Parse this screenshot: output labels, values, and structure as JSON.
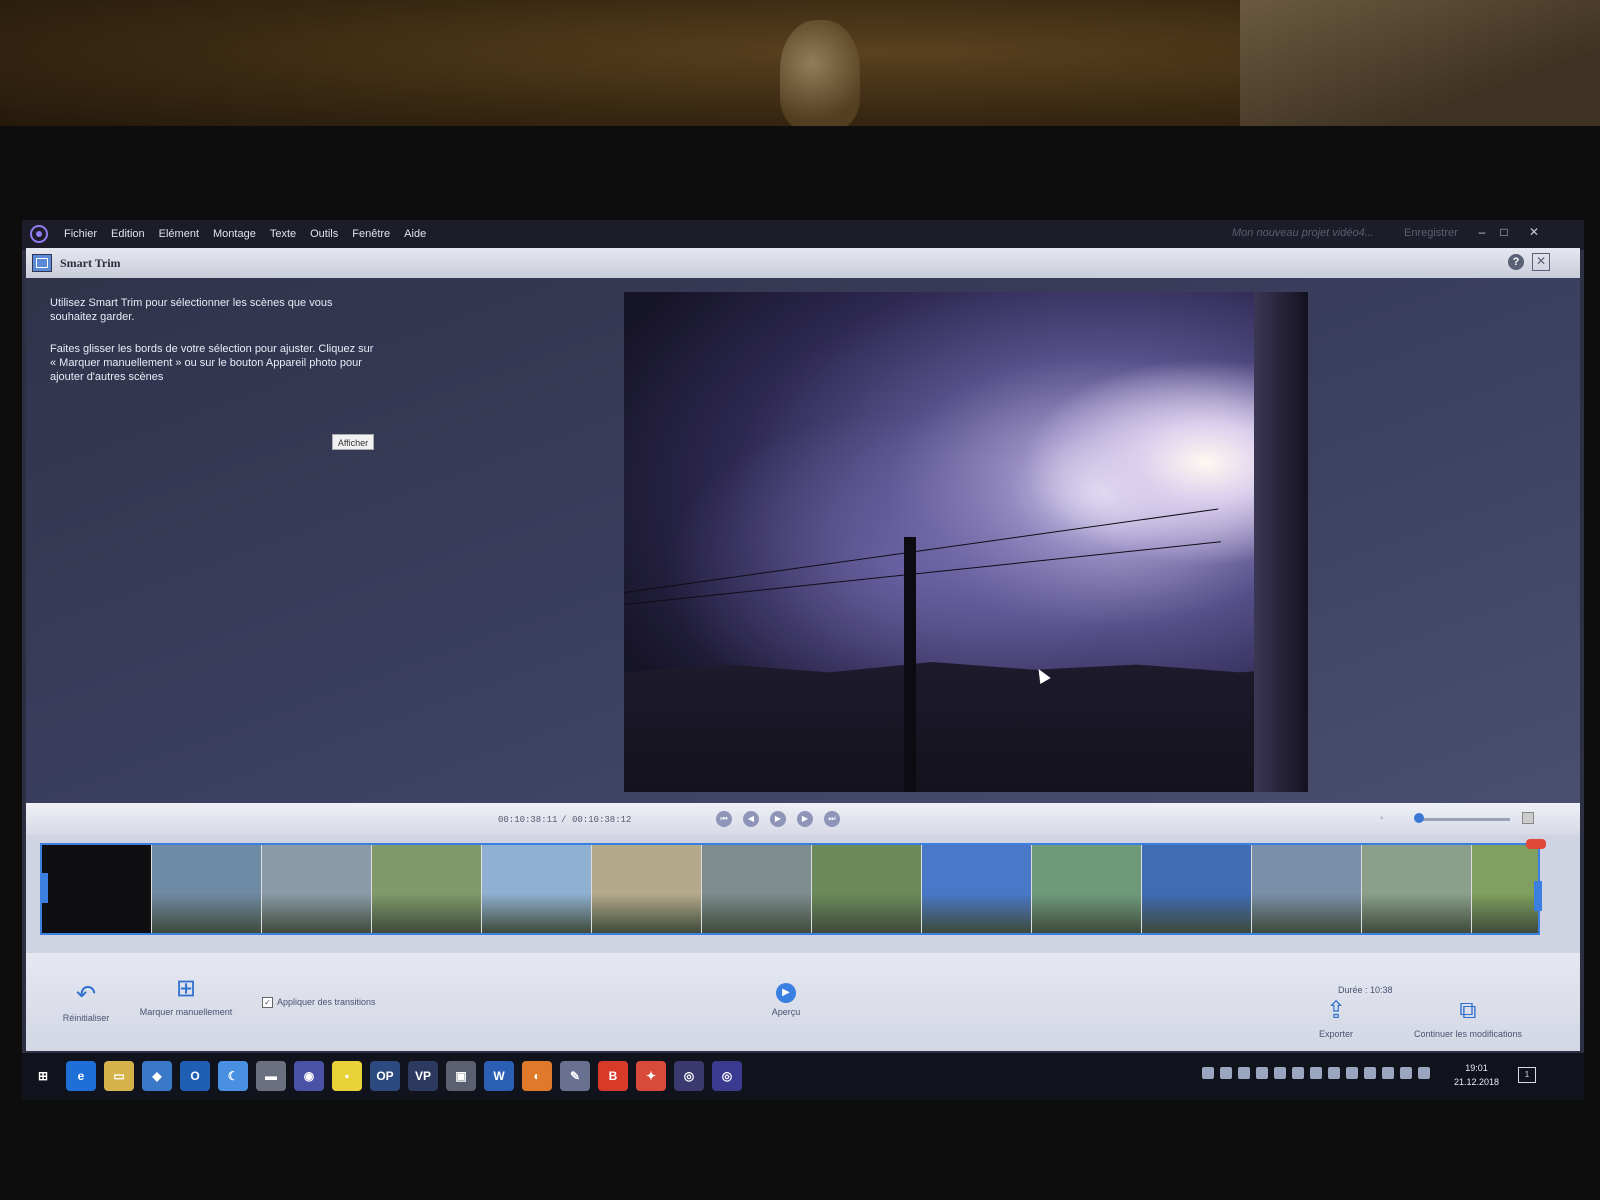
{
  "menubar": {
    "items": [
      "Fichier",
      "Edition",
      "Elément",
      "Montage",
      "Texte",
      "Outils",
      "Fenêtre",
      "Aide"
    ],
    "project_title": "Mon nouveau projet vidéo4...",
    "save_label": "Enregistrer"
  },
  "panel": {
    "title": "Smart Trim",
    "help_label": "?",
    "close_label": "✕"
  },
  "instructions": {
    "paragraph1": "Utilisez Smart Trim pour sélectionner les scènes que vous souhaitez garder.",
    "paragraph2": "Faites glisser les bords de votre sélection pour ajuster. Cliquez sur « Marquer  manuellement » ou sur le bouton Appareil photo pour ajouter d'autres scènes",
    "show_button": "Afficher"
  },
  "transport": {
    "current_time": "00:10:38:11",
    "separator": "/",
    "total_time": "00:10:38:12",
    "buttons": [
      "first-frame-icon",
      "previous-frame-icon",
      "play-icon",
      "next-frame-icon",
      "last-frame-icon"
    ]
  },
  "filmstrip": {
    "thumbnails": [
      {
        "scene": "dark",
        "color": "#0f0f12"
      },
      {
        "scene": "village",
        "color": "#6f8aa4"
      },
      {
        "scene": "house",
        "color": "#8a9aa6"
      },
      {
        "scene": "trees",
        "color": "#7f9a6a"
      },
      {
        "scene": "town",
        "color": "#8fb0d0"
      },
      {
        "scene": "field",
        "color": "#b4a98a"
      },
      {
        "scene": "car",
        "color": "#7d8c8f"
      },
      {
        "scene": "bushes",
        "color": "#6a8a5a"
      },
      {
        "scene": "sky-blue",
        "color": "#4a78c8"
      },
      {
        "scene": "garden",
        "color": "#6f9a7a"
      },
      {
        "scene": "lake",
        "color": "#3f6cb4"
      },
      {
        "scene": "valley",
        "color": "#7a90a8"
      },
      {
        "scene": "yard",
        "color": "#8aa08a"
      },
      {
        "scene": "foliage",
        "color": "#7fa05e"
      }
    ]
  },
  "toolbar": {
    "reset_label": "Réinitialiser",
    "manual_mark_label": "Marquer manuellement",
    "transitions_label": "Appliquer des transitions",
    "transitions_checked": true,
    "preview_label": "Aperçu",
    "duration_label": "Durée : 10:38",
    "export_label": "Exporter",
    "continue_label": "Continuer les modifications"
  },
  "taskbar": {
    "apps": [
      {
        "name": "windows-start-icon",
        "label": "⊞",
        "color": "#10131c"
      },
      {
        "name": "edge-icon",
        "label": "e",
        "color": "#1f6fd8"
      },
      {
        "name": "file-explorer-icon",
        "label": "▭",
        "color": "#d6b24a"
      },
      {
        "name": "app-icon-4",
        "label": "◆",
        "color": "#3a78c8"
      },
      {
        "name": "outlook-icon",
        "label": "O",
        "color": "#1e5fb4"
      },
      {
        "name": "app-icon-6",
        "label": "☾",
        "color": "#4a90e2"
      },
      {
        "name": "app-icon-7",
        "label": "▬",
        "color": "#6a7080"
      },
      {
        "name": "app-icon-8",
        "label": "◉",
        "color": "#4a52a8"
      },
      {
        "name": "sticky-notes-icon",
        "label": "▪",
        "color": "#e8d23a"
      },
      {
        "name": "app-op-icon",
        "label": "OP",
        "color": "#2c4a80"
      },
      {
        "name": "app-vp-icon",
        "label": "VP",
        "color": "#2c3a60"
      },
      {
        "name": "app-icon-12",
        "label": "▣",
        "color": "#5a6070"
      },
      {
        "name": "word-icon",
        "label": "W",
        "color": "#2b5fb4"
      },
      {
        "name": "firefox-icon",
        "label": "◐",
        "color": "#e07a2a"
      },
      {
        "name": "app-icon-15",
        "label": "✎",
        "color": "#6a7090"
      },
      {
        "name": "app-b-icon",
        "label": "B",
        "color": "#d83a2a"
      },
      {
        "name": "app-icon-17",
        "label": "✦",
        "color": "#d84a3a"
      },
      {
        "name": "app-icon-18",
        "label": "◎",
        "color": "#3a3a70"
      },
      {
        "name": "premiere-elements-icon",
        "label": "◎",
        "color": "#3a3a90"
      }
    ],
    "tray_count": 13,
    "time": "19:01",
    "date": "21.12.2018",
    "notifications": "1"
  }
}
